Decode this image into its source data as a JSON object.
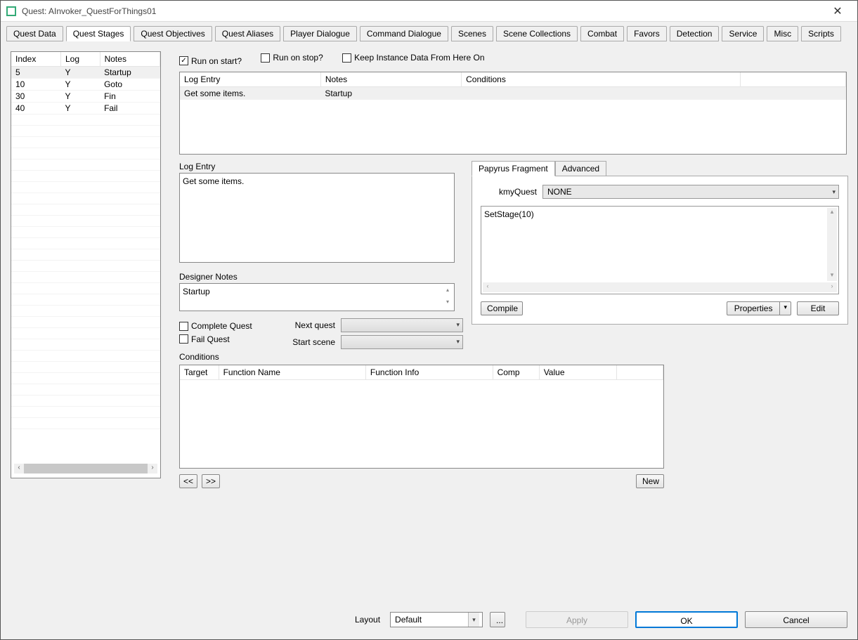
{
  "window": {
    "title": "Quest: AInvoker_QuestForThings01"
  },
  "tabs": [
    "Quest Data",
    "Quest Stages",
    "Quest Objectives",
    "Quest Aliases",
    "Player Dialogue",
    "Command Dialogue",
    "Scenes",
    "Scene Collections",
    "Combat",
    "Favors",
    "Detection",
    "Service",
    "Misc",
    "Scripts"
  ],
  "active_tab": 1,
  "stages_table": {
    "headers": [
      "Index",
      "Log",
      "Notes"
    ],
    "rows": [
      {
        "index": "5",
        "log": "Y",
        "notes": "Startup",
        "selected": true
      },
      {
        "index": "10",
        "log": "Y",
        "notes": "Goto"
      },
      {
        "index": "30",
        "log": "Y",
        "notes": "Fin"
      },
      {
        "index": "40",
        "log": "Y",
        "notes": "Fail"
      }
    ]
  },
  "checkboxes": {
    "run_on_start": {
      "label": "Run on start?",
      "checked": true
    },
    "run_on_stop": {
      "label": "Run on stop?",
      "checked": false
    },
    "keep_instance": {
      "label": "Keep Instance Data From Here On",
      "checked": false
    }
  },
  "log_items_table": {
    "headers": [
      "Log Entry",
      "Notes",
      "Conditions"
    ],
    "rows": [
      {
        "log_entry": "Get some items.",
        "notes": "Startup",
        "conditions": ""
      }
    ]
  },
  "log_entry": {
    "label": "Log Entry",
    "value": "Get some items."
  },
  "designer_notes": {
    "label": "Designer Notes",
    "value": "Startup"
  },
  "complete_quest": {
    "label": "Complete Quest",
    "checked": false
  },
  "fail_quest": {
    "label": "Fail Quest",
    "checked": false
  },
  "next_quest": {
    "label": "Next quest",
    "value": ""
  },
  "start_scene": {
    "label": "Start scene",
    "value": ""
  },
  "conditions": {
    "label": "Conditions",
    "headers": [
      "Target",
      "Function Name",
      "Function Info",
      "Comp",
      "Value"
    ]
  },
  "nav": {
    "prev": "<<",
    "next": ">>",
    "new": "New"
  },
  "papyrus": {
    "tabs": [
      "Papyrus Fragment",
      "Advanced"
    ],
    "active": 0,
    "kmy_label": "kmyQuest",
    "kmy_value": "NONE",
    "code": "SetStage(10)",
    "compile": "Compile",
    "properties": "Properties",
    "edit": "Edit"
  },
  "footer": {
    "layout_label": "Layout",
    "layout_value": "Default",
    "dots": "...",
    "apply": "Apply",
    "ok": "OK",
    "cancel": "Cancel"
  }
}
